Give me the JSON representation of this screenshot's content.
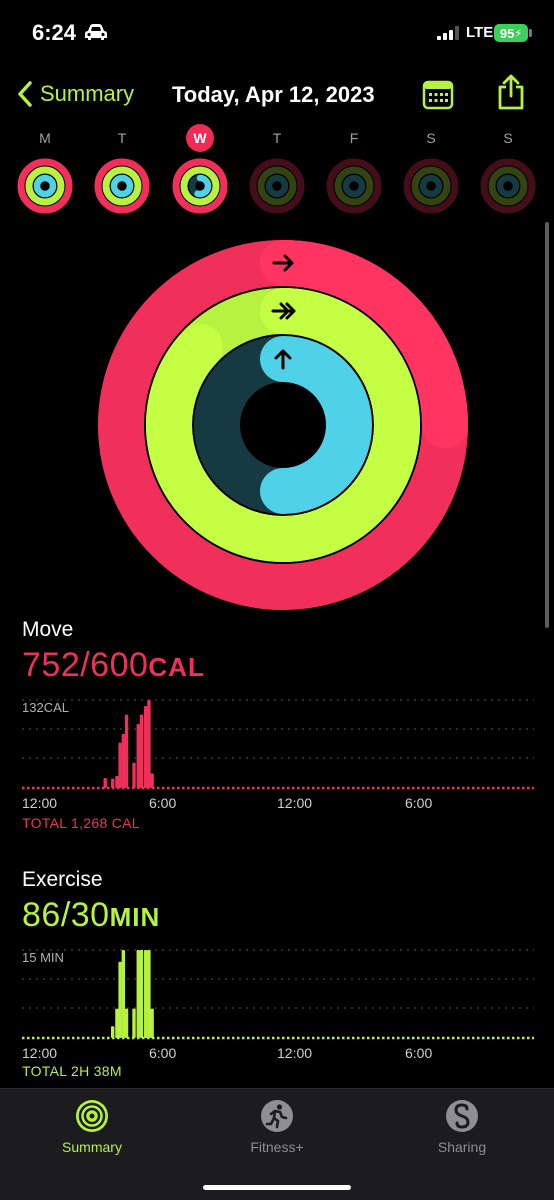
{
  "status_bar": {
    "time": "6:24",
    "network": "LTE",
    "battery": "95"
  },
  "nav": {
    "back_label": "Summary",
    "title": "Today, Apr 12, 2023"
  },
  "week": {
    "days": [
      {
        "letter": "M",
        "move": 1.0,
        "exercise": 1.0,
        "stand": 1.0,
        "selected": false
      },
      {
        "letter": "T",
        "move": 1.0,
        "exercise": 1.0,
        "stand": 1.0,
        "selected": false
      },
      {
        "letter": "W",
        "move": 1.0,
        "exercise": 1.0,
        "stand": 0.55,
        "selected": true
      },
      {
        "letter": "T",
        "move": 0,
        "exercise": 0,
        "stand": 0,
        "selected": false
      },
      {
        "letter": "F",
        "move": 0,
        "exercise": 0,
        "stand": 0,
        "selected": false
      },
      {
        "letter": "S",
        "move": 0,
        "exercise": 0,
        "stand": 0,
        "selected": false
      },
      {
        "letter": "S",
        "move": 0,
        "exercise": 0,
        "stand": 0,
        "selected": false
      }
    ]
  },
  "rings": {
    "move_progress": 1.25,
    "exercise_progress": 2.87,
    "stand_progress": 0.5
  },
  "colors": {
    "move": "#f0305a",
    "exercise": "#b6f23f",
    "stand": "#4fd1e8",
    "background": "#000000",
    "tabbar": "#1c1c1e"
  },
  "move": {
    "label": "Move",
    "value": "752/600",
    "unit": "CAL",
    "chart_max_label": "132CAL",
    "ticks": [
      "12:00",
      "6:00",
      "12:00",
      "6:00"
    ],
    "total": "TOTAL 1,268 CAL"
  },
  "exercise": {
    "label": "Exercise",
    "value": "86/30",
    "unit": "MIN",
    "chart_max_label": "15 MIN",
    "ticks": [
      "12:00",
      "6:00",
      "12:00",
      "6:00"
    ],
    "total": "TOTAL 2H 38M"
  },
  "chart_data": [
    {
      "type": "bar",
      "title": "Move",
      "ylabel": "CAL",
      "ylim": [
        0,
        132
      ],
      "x_unit": "time of day (hours since 12:00 AM)",
      "x_ticks": [
        "12:00",
        "6:00",
        "12:00",
        "6:00"
      ],
      "x": [
        3.9,
        4.25,
        4.45,
        4.6,
        4.75,
        4.9,
        5.25,
        5.45,
        5.6,
        5.8,
        5.95,
        6.1
      ],
      "values": [
        15,
        14,
        18,
        68,
        81,
        110,
        38,
        96,
        110,
        123,
        132,
        22
      ],
      "baseline_values": 3
    },
    {
      "type": "bar",
      "title": "Exercise",
      "ylabel": "MIN",
      "ylim": [
        0,
        15
      ],
      "x_unit": "time of day (hours since 12:00 AM)",
      "x_ticks": [
        "12:00",
        "6:00",
        "12:00",
        "6:00"
      ],
      "x": [
        4.25,
        4.45,
        4.6,
        4.75,
        4.9,
        5.25,
        5.45,
        5.6,
        5.8,
        5.95,
        6.1
      ],
      "values": [
        2,
        5,
        13,
        15,
        5,
        5,
        15,
        15,
        15,
        15,
        5
      ],
      "baseline_values": 0.3
    }
  ],
  "tabs": [
    {
      "label": "Summary",
      "active": true
    },
    {
      "label": "Fitness+",
      "active": false
    },
    {
      "label": "Sharing",
      "active": false
    }
  ]
}
